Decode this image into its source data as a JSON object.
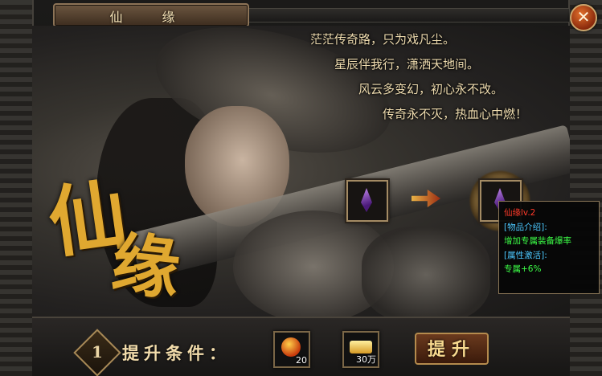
{
  "window": {
    "title": "仙 缘",
    "close_label": "✕"
  },
  "poem": [
    "茫茫传奇路，只为戏凡尘。",
    "星辰伴我行，潇洒天地间。",
    "风云多变幻，初心永不改。",
    "传奇永不灭，热血心中燃！"
  ],
  "calligraphy": {
    "char1": "仙",
    "char2": "缘"
  },
  "upgrade": {
    "from_item_icon": "purple-gem-icon",
    "to_item_icon": "purple-gem-icon",
    "arrow_icon": "arrow-right-icon"
  },
  "tooltip": {
    "name": "仙缘lv.2",
    "intro_header": "[物品介绍]:",
    "intro_text": "增加专属装备爆率",
    "attr_header": "[属性激活]:",
    "attr_text": "专属+6%"
  },
  "bottom": {
    "level": "1",
    "condition_label": "提升条件：",
    "costs": [
      {
        "icon": "fire-orb-icon",
        "quantity": "20"
      },
      {
        "icon": "gold-ingot-icon",
        "quantity": "30万"
      }
    ],
    "upgrade_button": "提升"
  },
  "colors": {
    "accent_gold": "#e0a830",
    "tooltip_name": "#ff3a2a",
    "tooltip_header": "#4cc8ff",
    "tooltip_value": "#3cff47"
  }
}
